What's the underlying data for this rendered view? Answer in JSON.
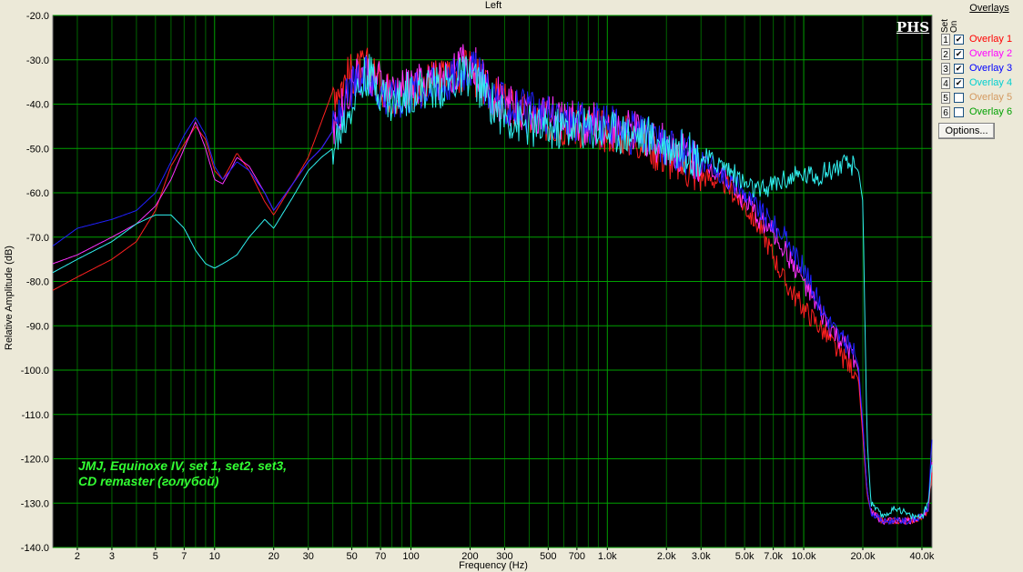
{
  "chart_data": {
    "type": "line",
    "title": "Left",
    "xlabel": "Frequency (Hz)",
    "ylabel": "Relative Amplitude (dB)",
    "x_scale": "log",
    "xlim": [
      1.5,
      45000
    ],
    "ylim": [
      -140,
      -20
    ],
    "grid": true,
    "x_ticks": [
      {
        "v": 2,
        "label": "2"
      },
      {
        "v": 3,
        "label": "3"
      },
      {
        "v": 5,
        "label": "5"
      },
      {
        "v": 7,
        "label": "7"
      },
      {
        "v": 10,
        "label": "10"
      },
      {
        "v": 20,
        "label": "20"
      },
      {
        "v": 30,
        "label": "30"
      },
      {
        "v": 50,
        "label": "50"
      },
      {
        "v": 70,
        "label": "70"
      },
      {
        "v": 100,
        "label": "100"
      },
      {
        "v": 200,
        "label": "200"
      },
      {
        "v": 300,
        "label": "300"
      },
      {
        "v": 500,
        "label": "500"
      },
      {
        "v": 700,
        "label": "700"
      },
      {
        "v": 1000,
        "label": "1.0k"
      },
      {
        "v": 2000,
        "label": "2.0k"
      },
      {
        "v": 3000,
        "label": "3.0k"
      },
      {
        "v": 5000,
        "label": "5.0k"
      },
      {
        "v": 7000,
        "label": "7.0k"
      },
      {
        "v": 10000,
        "label": "10.0k"
      },
      {
        "v": 20000,
        "label": "20.0k"
      },
      {
        "v": 40000,
        "label": "40.0k"
      }
    ],
    "y_ticks": [
      {
        "v": -20,
        "label": "-20.0"
      },
      {
        "v": -30,
        "label": "-30.0"
      },
      {
        "v": -40,
        "label": "-40.0"
      },
      {
        "v": -50,
        "label": "-50.0"
      },
      {
        "v": -60,
        "label": "-60.0"
      },
      {
        "v": -70,
        "label": "-70.0"
      },
      {
        "v": -80,
        "label": "-80.0"
      },
      {
        "v": -90,
        "label": "-90.0"
      },
      {
        "v": -100,
        "label": "-100.0"
      },
      {
        "v": -110,
        "label": "-110.0"
      },
      {
        "v": -120,
        "label": "-120.0"
      },
      {
        "v": -130,
        "label": "-130.0"
      },
      {
        "v": -140,
        "label": "-140.0"
      }
    ],
    "series": [
      {
        "name": "Overlay 1",
        "color": "#ff2020",
        "x": [
          1.5,
          2,
          3,
          4,
          5,
          6,
          7,
          8,
          9,
          10,
          11,
          12,
          13,
          15,
          18,
          20,
          25,
          30,
          35,
          40,
          50,
          60,
          80,
          100,
          150,
          200,
          250,
          300,
          400,
          500,
          700,
          1000,
          1500,
          2000,
          3000,
          4000,
          5000,
          6000,
          7000,
          8000,
          10000,
          12000,
          15000,
          18000,
          19000,
          20000,
          21000,
          22000,
          25000,
          30000,
          35000,
          40000,
          43000,
          45000
        ],
        "y": [
          -82,
          -79,
          -75,
          -71,
          -64,
          -54,
          -49,
          -45,
          -48,
          -55,
          -57,
          -54,
          -51,
          -55,
          -62,
          -65,
          -58,
          -52,
          -44,
          -37,
          -33,
          -32,
          -38,
          -37,
          -34,
          -32,
          -38,
          -40,
          -43,
          -44,
          -45,
          -46,
          -48,
          -52,
          -56,
          -58,
          -63,
          -68,
          -74,
          -80,
          -86,
          -90,
          -96,
          -100,
          -102,
          -115,
          -128,
          -132,
          -134,
          -134,
          -134,
          -133,
          -132,
          -123
        ]
      },
      {
        "name": "Overlay 2",
        "color": "#ff30ff",
        "x": [
          1.5,
          2,
          3,
          4,
          5,
          6,
          7,
          8,
          9,
          10,
          11,
          12,
          13,
          15,
          18,
          20,
          25,
          30,
          35,
          40,
          50,
          60,
          80,
          100,
          150,
          200,
          250,
          300,
          400,
          500,
          700,
          1000,
          1500,
          2000,
          3000,
          4000,
          5000,
          6000,
          7000,
          8000,
          10000,
          12000,
          15000,
          18000,
          19000,
          20000,
          21000,
          22000,
          25000,
          30000,
          35000,
          40000,
          43000,
          45000
        ],
        "y": [
          -76,
          -74,
          -70,
          -67,
          -63,
          -57,
          -50,
          -44,
          -50,
          -57,
          -58,
          -55,
          -52,
          -54,
          -60,
          -64,
          -58,
          -53,
          -50,
          -46,
          -35,
          -33,
          -38,
          -36,
          -34,
          -30,
          -37,
          -40,
          -42,
          -43,
          -44,
          -45,
          -47,
          -49,
          -53,
          -56,
          -62,
          -66,
          -69,
          -73,
          -80,
          -87,
          -93,
          -97,
          -100,
          -113,
          -127,
          -132,
          -134,
          -134,
          -134,
          -133,
          -131,
          -120
        ]
      },
      {
        "name": "Overlay 3",
        "color": "#2020ff",
        "x": [
          1.5,
          2,
          3,
          4,
          5,
          6,
          7,
          8,
          9,
          10,
          11,
          12,
          13,
          15,
          18,
          20,
          25,
          30,
          35,
          40,
          50,
          60,
          80,
          100,
          150,
          200,
          250,
          300,
          400,
          500,
          700,
          1000,
          1500,
          2000,
          3000,
          4000,
          5000,
          6000,
          7000,
          8000,
          10000,
          12000,
          15000,
          18000,
          19000,
          20000,
          21000,
          22000,
          25000,
          30000,
          35000,
          40000,
          43000,
          45000
        ],
        "y": [
          -72,
          -68,
          -66,
          -64,
          -60,
          -53,
          -47,
          -43,
          -47,
          -54,
          -57,
          -55,
          -53,
          -55,
          -60,
          -64,
          -58,
          -53,
          -50,
          -46,
          -36,
          -34,
          -39,
          -37,
          -35,
          -31,
          -37,
          -40,
          -42,
          -43,
          -44,
          -45,
          -47,
          -49,
          -53,
          -56,
          -60,
          -64,
          -67,
          -70,
          -77,
          -85,
          -92,
          -96,
          -99,
          -112,
          -127,
          -132,
          -134,
          -134,
          -134,
          -133,
          -131,
          -116
        ]
      },
      {
        "name": "Overlay 4",
        "color": "#30f0f0",
        "x": [
          1.5,
          2,
          3,
          4,
          5,
          6,
          7,
          8,
          9,
          10,
          11,
          12,
          13,
          15,
          18,
          20,
          25,
          30,
          35,
          40,
          50,
          60,
          80,
          100,
          150,
          200,
          250,
          300,
          400,
          500,
          700,
          1000,
          1500,
          2000,
          3000,
          4000,
          5000,
          6000,
          7000,
          8000,
          10000,
          12000,
          15000,
          18000,
          19000,
          20000,
          21000,
          22000,
          25000,
          30000,
          35000,
          40000,
          43000,
          45000
        ],
        "y": [
          -78,
          -75,
          -71,
          -67,
          -65,
          -65,
          -68,
          -73,
          -76,
          -77,
          -76,
          -75,
          -74,
          -70,
          -66,
          -68,
          -61,
          -55,
          -52,
          -50,
          -40,
          -33,
          -40,
          -37,
          -36,
          -33,
          -39,
          -43,
          -45,
          -46,
          -45,
          -46,
          -47,
          -49,
          -52,
          -54,
          -58,
          -60,
          -58,
          -57,
          -56,
          -56,
          -54,
          -54,
          -55,
          -62,
          -115,
          -130,
          -133,
          -131,
          -133,
          -133,
          -130,
          -121
        ]
      },
      {
        "name": "Overlay 5",
        "color": "#d4a070",
        "x": [],
        "y": []
      },
      {
        "name": "Overlay 6",
        "color": "#10b010",
        "x": [],
        "y": []
      }
    ]
  },
  "panel": {
    "title": "Overlays",
    "col_set": "Set",
    "col_on": "On",
    "options_label": "Options...",
    "overlays": [
      {
        "num": "1",
        "label": "Overlay 1",
        "checked": true,
        "color": "#ff0000"
      },
      {
        "num": "2",
        "label": "Overlay 2",
        "checked": true,
        "color": "#ff00ff"
      },
      {
        "num": "3",
        "label": "Overlay 3",
        "checked": true,
        "color": "#0000ff"
      },
      {
        "num": "4",
        "label": "Overlay 4",
        "checked": true,
        "color": "#00d0d0"
      },
      {
        "num": "5",
        "label": "Overlay 5",
        "checked": false,
        "color": "#d49a60"
      },
      {
        "num": "6",
        "label": "Overlay 6",
        "checked": false,
        "color": "#00a000"
      }
    ]
  },
  "logo_text": "PHS",
  "annotation": "JMJ, Equinoxe IV, set 1, set2, set3,\nCD remaster (голубой)"
}
